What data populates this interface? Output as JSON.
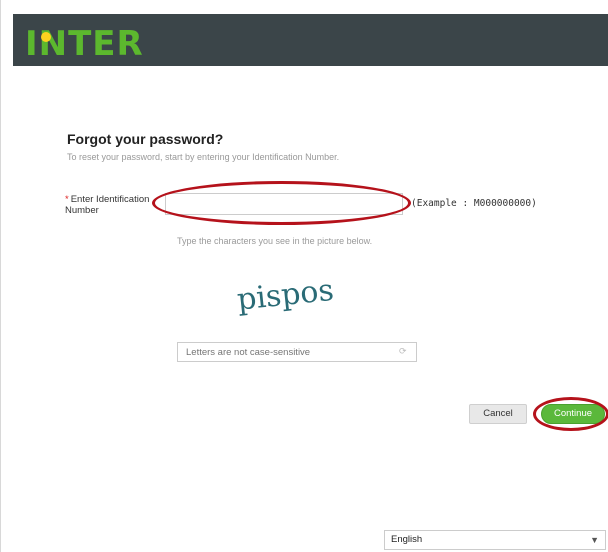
{
  "header": {
    "logo_text": "INTER",
    "colors": {
      "bar": "#3b4549",
      "logo": "#5cb82e",
      "dot": "#ffd21f"
    }
  },
  "form": {
    "title": "Forgot your password?",
    "subtitle": "To reset your password, start by entering your Identification Number.",
    "required_marker": "*",
    "id_label": "Enter Identification Number",
    "id_value": "",
    "id_example": "(Example : M000000000)",
    "captcha_help": "Type the characters you see in the picture below.",
    "captcha_text": "pispos",
    "captcha_placeholder": "Letters are not case-sensitive"
  },
  "buttons": {
    "cancel": "Cancel",
    "continue": "Continue"
  },
  "language": {
    "selected": "English"
  },
  "icons": {
    "chevron": "chevron-down-icon",
    "refresh": "refresh-icon"
  }
}
